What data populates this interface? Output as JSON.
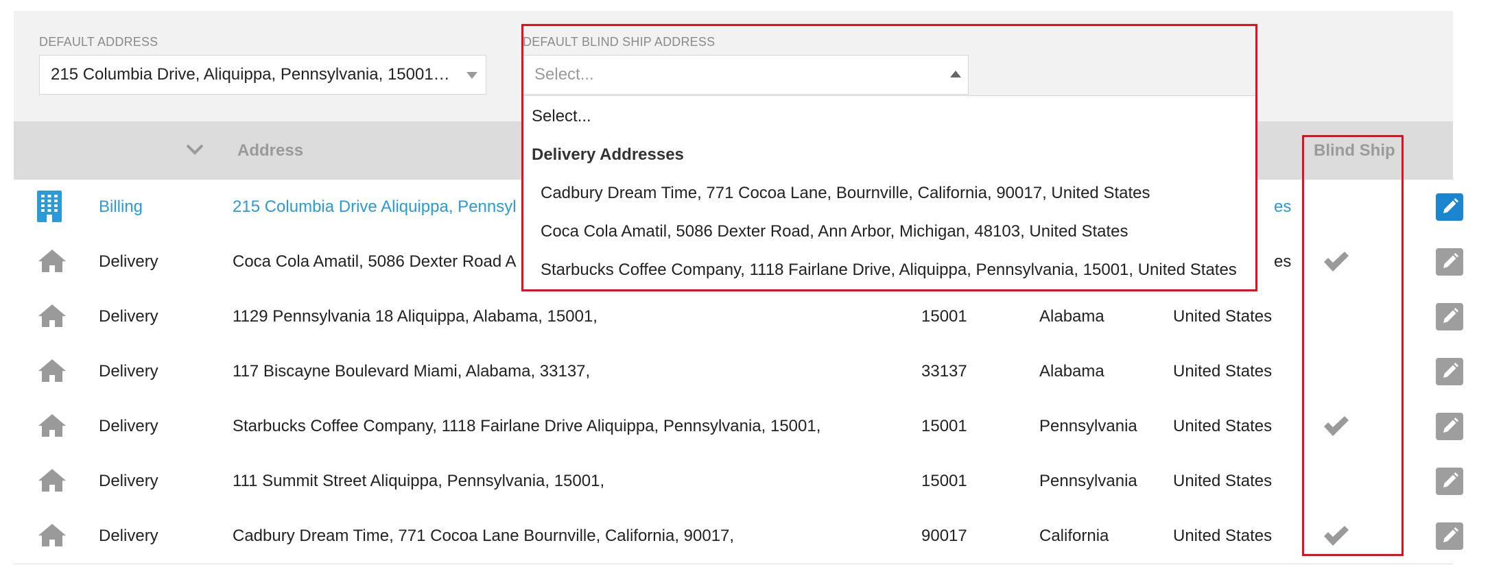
{
  "default_address": {
    "label": "DEFAULT ADDRESS",
    "value": "215 Columbia Drive, Aliquippa, Pennsylvania, 15001…"
  },
  "default_blind_ship": {
    "label": "DEFAULT BLIND SHIP ADDRESS",
    "placeholder": "Select...",
    "options": {
      "first": "Select...",
      "group_label": "Delivery Addresses",
      "items": [
        "Cadbury Dream Time, 771 Cocoa Lane, Bournville, California, 90017, United States",
        "Coca Cola Amatil, 5086 Dexter Road, Ann Arbor, Michigan, 48103, United States",
        "Starbucks Coffee Company, 1118 Fairlane Drive, Aliquippa, Pennsylvania, 15001, United States"
      ]
    }
  },
  "table": {
    "headers": {
      "address": "Address",
      "blind_ship": "Blind Ship"
    },
    "rows": [
      {
        "type": "Billing",
        "icon": "building-icon",
        "address": "215 Columbia Drive Aliquippa, Pennsyl",
        "zip": "",
        "state": "",
        "country": "es",
        "blind_ship": false
      },
      {
        "type": "Delivery",
        "icon": "home-icon",
        "address": "Coca Cola Amatil, 5086 Dexter Road A",
        "zip": "",
        "state": "",
        "country": "es",
        "blind_ship": true
      },
      {
        "type": "Delivery",
        "icon": "home-icon",
        "address": "1129 Pennsylvania 18 Aliquippa, Alabama, 15001,",
        "zip": "15001",
        "state": "Alabama",
        "country": "United States",
        "blind_ship": false
      },
      {
        "type": "Delivery",
        "icon": "home-icon",
        "address": "117 Biscayne Boulevard Miami, Alabama, 33137,",
        "zip": "33137",
        "state": "Alabama",
        "country": "United States",
        "blind_ship": false
      },
      {
        "type": "Delivery",
        "icon": "home-icon",
        "address": "Starbucks Coffee Company, 1118 Fairlane Drive Aliquippa, Pennsylvania, 15001,",
        "zip": "15001",
        "state": "Pennsylvania",
        "country": "United States",
        "blind_ship": true
      },
      {
        "type": "Delivery",
        "icon": "home-icon",
        "address": "111 Summit Street Aliquippa, Pennsylvania, 15001,",
        "zip": "15001",
        "state": "Pennsylvania",
        "country": "United States",
        "blind_ship": false
      },
      {
        "type": "Delivery",
        "icon": "home-icon",
        "address": "Cadbury Dream Time, 771 Cocoa Lane Bournville, California, 90017,",
        "zip": "90017",
        "state": "California",
        "country": "United States",
        "blind_ship": true
      }
    ]
  },
  "colors": {
    "link": "#2a9bd8",
    "primary_button": "#1a86cf",
    "muted_button": "#9e9e9e",
    "highlight": "#e0101e"
  }
}
